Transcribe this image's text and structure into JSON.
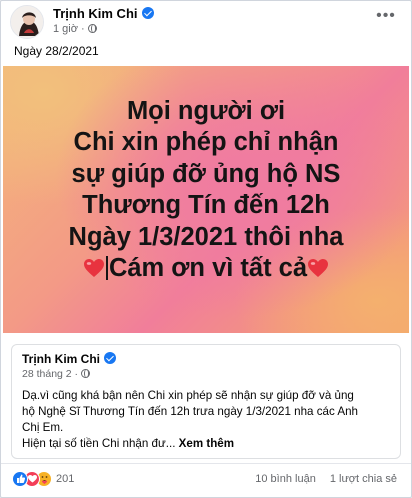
{
  "post": {
    "author": "Trịnh Kim Chi",
    "time": "1 giờ ·",
    "text": "Ngày 28/2/2021"
  },
  "banner": {
    "lines": [
      "Mọi người ơi",
      "Chi xin phép chỉ nhận",
      "sự giúp đỡ ủng hộ NS",
      "Thương Tín đến 12h",
      "Ngày 1/3/2021 thôi nha"
    ],
    "last_line": "Cám ơn vì tất cả"
  },
  "shared": {
    "author": "Trịnh Kim Chi",
    "time": "28 tháng 2 ·",
    "body_lines": [
      "Dạ.vì cũng khá bận nên Chi xin phép sẽ nhận sự giúp đỡ và ủng",
      "hộ Nghệ Sĩ Thương Tín đến 12h trưa ngày 1/3/2021 nha các Anh",
      "Chị Em."
    ],
    "body2": "Hiện tại số tiền Chi nhận đư...",
    "see_more": "Xem thêm"
  },
  "footer": {
    "reaction_count": "201",
    "comments": "10 bình luận",
    "shares": "1 lượt chia sẻ"
  },
  "colors": {
    "accent": "#1877f2",
    "love": "#f33e58",
    "care": "#f7b125",
    "heart": "#e8333f"
  }
}
